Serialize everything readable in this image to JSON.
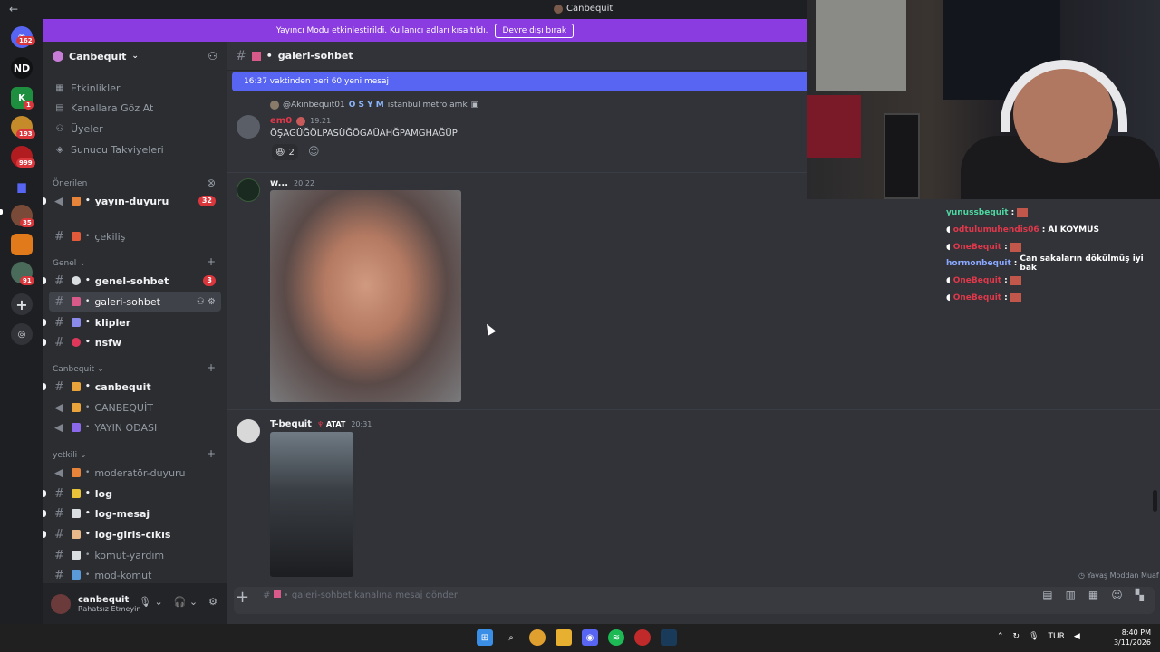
{
  "window": {
    "back_icon": "back-arrow-icon",
    "title": "Canbequit"
  },
  "banner": {
    "text": "Yayıncı Modu etkinleştirildi. Kullanıcı adları kısaltıldı.",
    "button": "Devre dışı bırak"
  },
  "rail": {
    "badges": [
      "162",
      "1",
      "193",
      "999",
      "35",
      "91"
    ],
    "dm_label": "ND"
  },
  "server": {
    "name": "Canbequit"
  },
  "sidebar_rows": [
    {
      "label": "Etkinlikler",
      "icon": "calendar-icon"
    },
    {
      "label": "Kanallara Göz At",
      "icon": "browse-icon"
    },
    {
      "label": "Üyeler",
      "icon": "members-icon"
    },
    {
      "label": "Sunucu Takviyeleri",
      "icon": "boost-icon"
    }
  ],
  "categories": {
    "suggested": "Önerilen",
    "general": "Genel",
    "canbequit": "Canbequit",
    "staff": "yetkili"
  },
  "channels": {
    "suggested": [
      {
        "name": "yayın-duyuru",
        "count": "32"
      },
      {
        "name": "çekiliş"
      }
    ],
    "general": [
      {
        "name": "genel-sohbet",
        "count": "3"
      },
      {
        "name": "galeri-sohbet"
      },
      {
        "name": "klipler"
      },
      {
        "name": "nsfw"
      }
    ],
    "canbequit": [
      {
        "name": "canbequit"
      },
      {
        "name": "CANBEQUİT"
      },
      {
        "name": "YAYIN ODASI"
      }
    ],
    "staff": [
      {
        "name": "moderatör-duyuru"
      },
      {
        "name": "log"
      },
      {
        "name": "log-mesaj"
      },
      {
        "name": "log-giris-cıkıs"
      },
      {
        "name": "komut-yardım"
      },
      {
        "name": "mod-komut"
      }
    ]
  },
  "user": {
    "name": "canbequit",
    "status": "Rahatsız Etmeyin"
  },
  "channel_header": {
    "name": "galeri-sohbet"
  },
  "new_messages": "16:37 vaktinden beri 60 yeni mesaj",
  "messages": [
    {
      "reply_author": "@Akinbequit01",
      "reply_tag": "O S Y M",
      "reply_text": "istanbul metro amk",
      "author": "em0",
      "time": "19:21",
      "text": "ÖŞAGÜĞÖLPASÜĞÖGAÜAHĞPAMGHAĞÜP",
      "reaction_count": "2"
    },
    {
      "author": "w...",
      "time": "20:22"
    },
    {
      "author": "T-bequit",
      "tag": "ATAT",
      "time": "20:31"
    }
  ],
  "composer": {
    "placeholder": "galeri-sohbet kanalına mesaj gönder"
  },
  "slowmode": "Yavaş Moddan Muaf",
  "stream_chat": [
    {
      "user": "yunussbequit",
      "color": "#4ed6a0",
      "text": ""
    },
    {
      "user": "odtulumuhendis06",
      "color": "#e0384b",
      "text": "AI KOYMUS"
    },
    {
      "user": "OneBequit",
      "color": "#e0384b",
      "text": ""
    },
    {
      "user": "hormonbequit",
      "color": "#8aa8ff",
      "text": "Can sakaların dökülmüş iyi bak"
    },
    {
      "user": "OneBequit",
      "color": "#e0384b",
      "text": ""
    },
    {
      "user": "OneBequit",
      "color": "#e0384b",
      "text": ""
    }
  ],
  "taskbar": {
    "lang": "TUR",
    "time": "8:40 PM",
    "date": "3/11/2026"
  },
  "colors": {
    "accent": "#5865f2",
    "banner": "#8a3ce0",
    "danger": "#da373c"
  }
}
